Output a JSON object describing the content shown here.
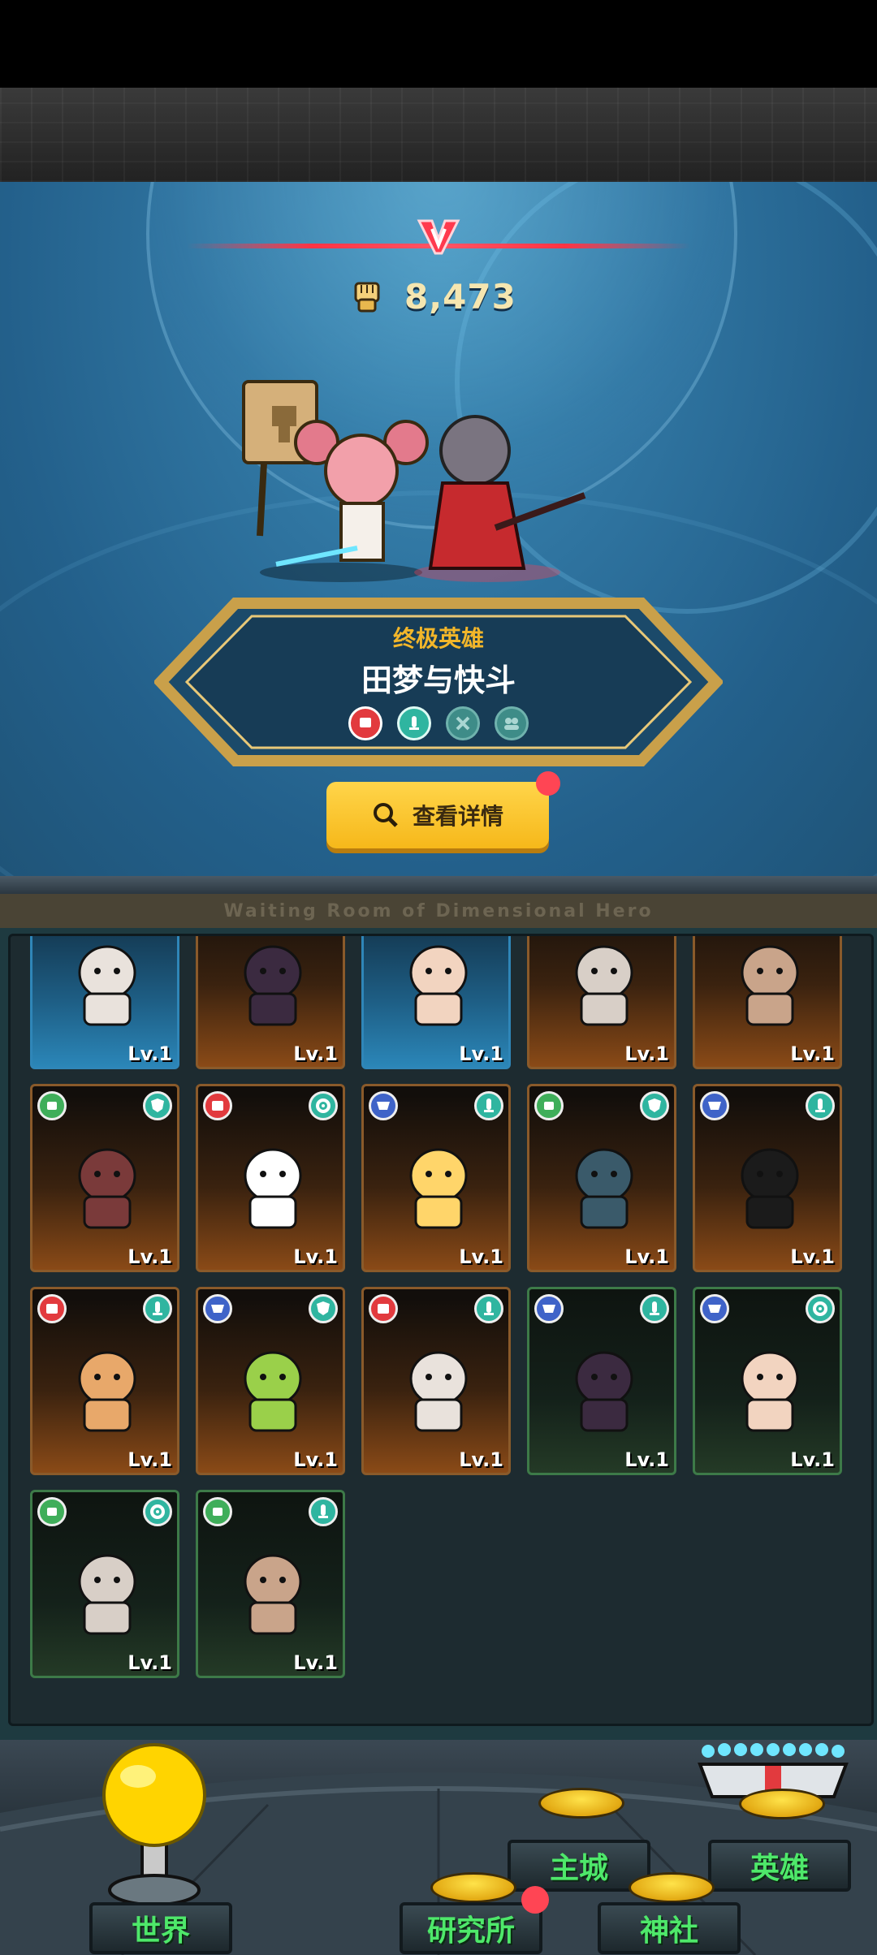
{
  "power": {
    "value": "8,473"
  },
  "hero": {
    "rank": "终极英雄",
    "name": "田梦与快斗",
    "traits": [
      {
        "icon": "red-fist-trait-icon",
        "color": "#e23a3e"
      },
      {
        "icon": "teal-sword-trait-icon",
        "color": "#2fb5a0"
      },
      {
        "icon": "locked-x-trait-icon",
        "color": "#3e8c88"
      },
      {
        "icon": "locked-group-trait-icon",
        "color": "#3e8c88"
      }
    ]
  },
  "detail_button": {
    "label": "查看详情"
  },
  "waiting_room": {
    "title": "Waiting Room of Dimensional Hero"
  },
  "roster": {
    "level_label": "Lv.1",
    "rows": [
      [
        {
          "style": "blue"
        },
        {
          "style": "orange"
        },
        {
          "style": "blue"
        },
        {
          "style": "orange"
        },
        {
          "style": "orange"
        }
      ],
      [
        {
          "style": "orange",
          "left": "green-hand",
          "right": "green-shield"
        },
        {
          "style": "orange",
          "left": "red-fist",
          "right": "green-gear"
        },
        {
          "style": "orange",
          "left": "blue-claw",
          "right": "teal-sword"
        },
        {
          "style": "orange",
          "left": "green-hand",
          "right": "green-shield"
        },
        {
          "style": "orange",
          "left": "blue-claw",
          "right": "teal-sword"
        }
      ],
      [
        {
          "style": "orange",
          "left": "red-fist",
          "right": "teal-sword"
        },
        {
          "style": "orange",
          "left": "blue-claw",
          "right": "green-shield"
        },
        {
          "style": "orange",
          "left": "red-fist",
          "right": "teal-sword"
        },
        {
          "style": "green",
          "left": "blue-claw",
          "right": "teal-sword"
        },
        {
          "style": "green",
          "left": "blue-claw",
          "right": "teal-gear"
        }
      ],
      [
        {
          "style": "green",
          "left": "green-hand",
          "right": "teal-gear"
        },
        {
          "style": "green",
          "left": "green-hand",
          "right": "teal-sword"
        }
      ]
    ]
  },
  "nav": {
    "world": "世界",
    "main_city": "主城",
    "heroes": "英雄",
    "research": "研究所",
    "shrine": "神社"
  }
}
